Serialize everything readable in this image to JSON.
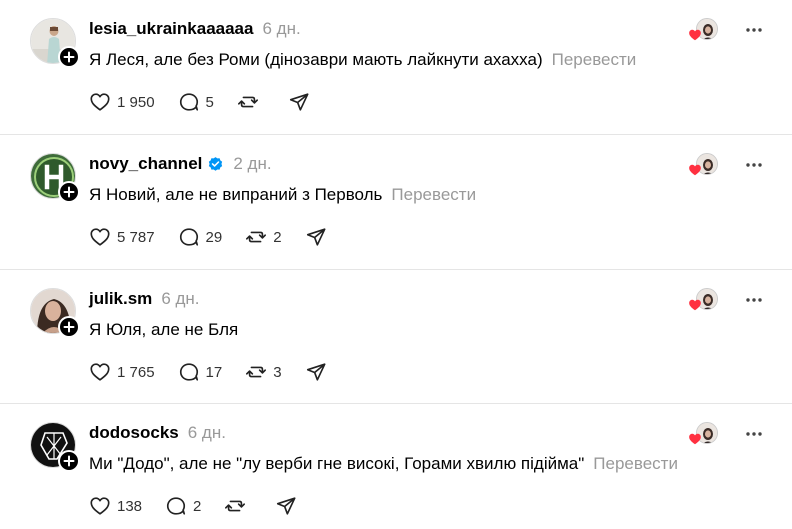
{
  "colors": {
    "meta_text": "#999999",
    "verified_blue": "#0095f6",
    "heart_red": "#ff3040",
    "divider": "#e5e5e5"
  },
  "posts": [
    {
      "username": "lesia_ukrainkaaaaaa",
      "verified": false,
      "time": "6 дн.",
      "text": "Я Леся, але без Роми (дінозаври мають лайкнути ахахха)",
      "translate": "Перевести",
      "likes": "1 950",
      "comments": "5",
      "reposts": "",
      "avatar_icon": "lesia-avatar"
    },
    {
      "username": "novy_channel",
      "verified": true,
      "time": "2 дн.",
      "text": "Я Новий, але не випраний з Перволь",
      "translate": "Перевести",
      "likes": "5 787",
      "comments": "29",
      "reposts": "2",
      "avatar_icon": "novy-channel-logo"
    },
    {
      "username": "julik.sm",
      "verified": false,
      "time": "6 дн.",
      "text": "Я Юля, але не Бля",
      "translate": "",
      "likes": "1 765",
      "comments": "17",
      "reposts": "3",
      "avatar_icon": "julik-avatar"
    },
    {
      "username": "dodosocks",
      "verified": false,
      "time": "6 дн.",
      "text": "Ми \"Додо\", але не \"лу верби гне високі, Горами хвилю підійма\"",
      "translate": "Перевести",
      "likes": "138",
      "comments": "2",
      "reposts": "",
      "avatar_icon": "dodosocks-logo"
    }
  ]
}
